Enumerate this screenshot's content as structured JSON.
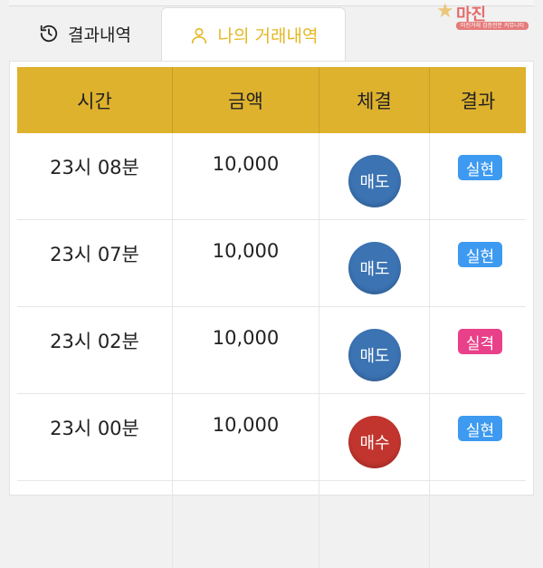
{
  "tabs": [
    {
      "label": "결과내역",
      "active": false
    },
    {
      "label": "나의 거래내역",
      "active": true
    }
  ],
  "watermark": {
    "text": "마진",
    "sub": "마진거래 검증전문 커뮤니티"
  },
  "table": {
    "headers": [
      "시간",
      "금액",
      "체결",
      "결과"
    ],
    "rows": [
      {
        "time": "23시 08분",
        "amount": "10,000",
        "trade": "매도",
        "trade_type": "sell",
        "result": "실현",
        "result_type": "ok"
      },
      {
        "time": "23시 07분",
        "amount": "10,000",
        "trade": "매도",
        "trade_type": "sell",
        "result": "실현",
        "result_type": "ok"
      },
      {
        "time": "23시 02분",
        "amount": "10,000",
        "trade": "매도",
        "trade_type": "sell",
        "result": "실격",
        "result_type": "fail"
      },
      {
        "time": "23시 00분",
        "amount": "10,000",
        "trade": "매수",
        "trade_type": "buy",
        "result": "실현",
        "result_type": "ok"
      }
    ]
  },
  "colors": {
    "header_bg": "#dfb22e",
    "active_tab": "#e4b824",
    "sell": "#3b73b3",
    "buy": "#c2352e",
    "result_ok": "#3d9af0",
    "result_fail": "#e9408a"
  }
}
